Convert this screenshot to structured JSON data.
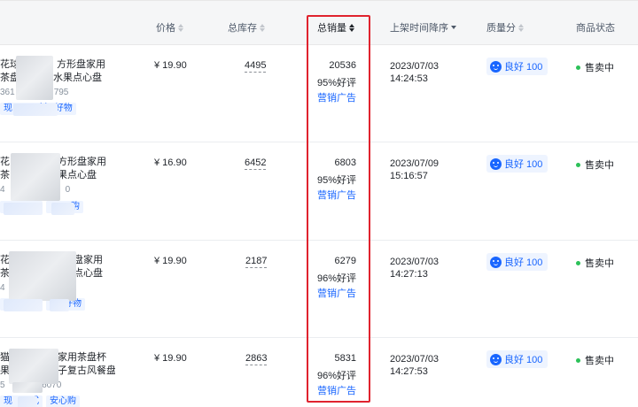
{
  "columns": {
    "price": "价格",
    "stock": "总库存",
    "sales": "总销量",
    "listing_time": "上架时间降序",
    "quality": "质量分",
    "status": "商品状态"
  },
  "highlight_color": "#e0232e",
  "rows": [
    {
      "name_line1": "花球",
      "name_line1b": "方形盘家用",
      "name_line2": "茶盘",
      "name_line2b": "水果点心盘",
      "id_prefix": "361",
      "id_suffix": "795",
      "tag1": "现",
      "tag2": "抖in好物",
      "price": "¥ 19.90",
      "stock": "4495",
      "sales": "20536",
      "rating": "95%好评",
      "ad": "营销广告",
      "date": "2023/07/03",
      "time": "14:24:53",
      "quality": "良好 100",
      "status": "售卖中"
    },
    {
      "name_line1": "花",
      "name_line1b": "方形盘家用",
      "name_line2": "茶",
      "name_line2b": "果点心盘",
      "id_prefix": "4",
      "id_suffix": "0",
      "tag1": "",
      "tag2": "购",
      "price": "¥ 16.90",
      "stock": "6452",
      "sales": "6803",
      "rating": "95%好评",
      "ad": "营销广告",
      "date": "2023/07/09",
      "time": "15:16:57",
      "quality": "良好 100",
      "status": "售卖中"
    },
    {
      "name_line1": "花",
      "name_line1b": "盘家用",
      "name_line2": "茶",
      "name_line2b": "点心盘",
      "id_prefix": "4",
      "id_suffix": "",
      "tag1": "",
      "tag2": "好物",
      "price": "¥ 19.90",
      "stock": "2187",
      "sales": "6279",
      "rating": "96%好评",
      "ad": "营销广告",
      "date": "2023/07/03",
      "time": "14:27:13",
      "quality": "良好 100",
      "status": "售卖中"
    },
    {
      "name_line1": "猫",
      "name_line1b": "家用茶盘杯",
      "name_line2": "果",
      "name_line2b": "子复古风餐盘",
      "id_prefix": "5",
      "id_suffix": "96070",
      "tag1": "现",
      "tag1b": "式",
      "tag2": "安心购",
      "price": "¥ 19.90",
      "stock": "2863",
      "sales": "5831",
      "rating": "96%好评",
      "ad": "营销广告",
      "date": "2023/07/03",
      "time": "14:27:53",
      "quality": "良好 100",
      "status": "售卖中"
    }
  ]
}
